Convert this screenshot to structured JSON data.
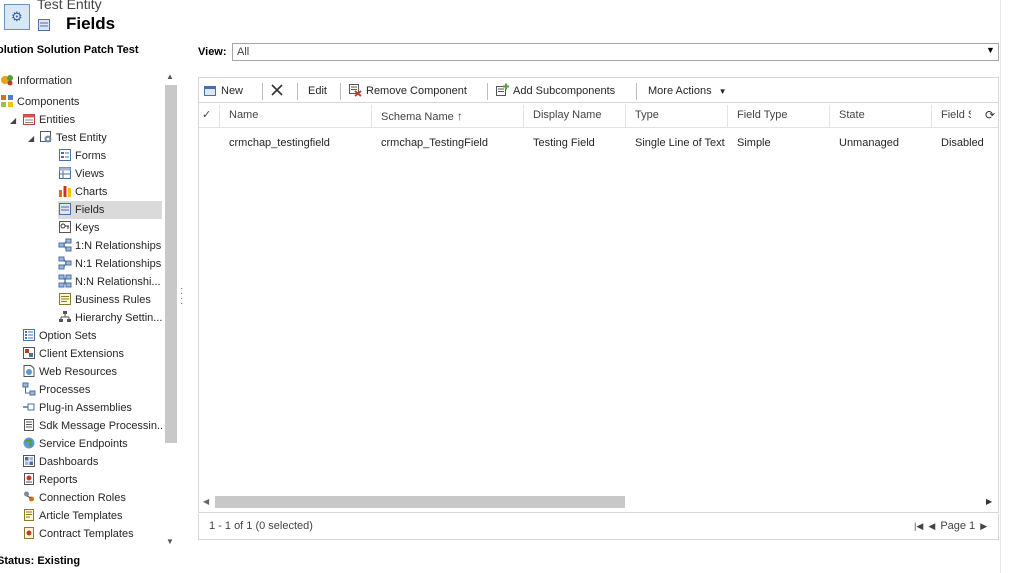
{
  "header": {
    "entity_title": "Test Entity",
    "page_title": "Fields"
  },
  "solution": {
    "title": "olution Solution Patch Test"
  },
  "nav": {
    "items": [
      {
        "label": "Information",
        "icon": "information-icon"
      },
      {
        "label": "Components",
        "icon": "components-icon"
      },
      {
        "label": "Entities",
        "icon": "entities-icon"
      },
      {
        "label": "Test Entity",
        "icon": "entity-icon"
      },
      {
        "label": "Forms",
        "icon": "forms-icon"
      },
      {
        "label": "Views",
        "icon": "views-icon"
      },
      {
        "label": "Charts",
        "icon": "charts-icon"
      },
      {
        "label": "Fields",
        "icon": "fields-icon",
        "selected": true
      },
      {
        "label": "Keys",
        "icon": "keys-icon"
      },
      {
        "label": "1:N Relationships",
        "icon": "relationship-icon"
      },
      {
        "label": "N:1 Relationships",
        "icon": "relationship-icon"
      },
      {
        "label": "N:N Relationshi...",
        "icon": "relationship-icon"
      },
      {
        "label": "Business Rules",
        "icon": "business-rules-icon"
      },
      {
        "label": "Hierarchy Settin...",
        "icon": "hierarchy-icon"
      },
      {
        "label": "Option Sets",
        "icon": "option-sets-icon"
      },
      {
        "label": "Client Extensions",
        "icon": "client-extensions-icon"
      },
      {
        "label": "Web Resources",
        "icon": "web-resources-icon"
      },
      {
        "label": "Processes",
        "icon": "processes-icon"
      },
      {
        "label": "Plug-in Assemblies",
        "icon": "plugin-icon"
      },
      {
        "label": "Sdk Message Processin...",
        "icon": "sdk-message-icon"
      },
      {
        "label": "Service Endpoints",
        "icon": "service-endpoints-icon"
      },
      {
        "label": "Dashboards",
        "icon": "dashboards-icon"
      },
      {
        "label": "Reports",
        "icon": "reports-icon"
      },
      {
        "label": "Connection Roles",
        "icon": "connection-roles-icon"
      },
      {
        "label": "Article Templates",
        "icon": "article-templates-icon"
      },
      {
        "label": "Contract Templates",
        "icon": "contract-templates-icon"
      }
    ]
  },
  "status": {
    "text": "Status: Existing"
  },
  "view": {
    "label": "View:",
    "selected": "All"
  },
  "toolbar": {
    "new_label": "New",
    "edit_label": "Edit",
    "remove_label": "Remove Component",
    "add_sub_label": "Add Subcomponents",
    "more_actions_label": "More Actions"
  },
  "grid": {
    "columns": [
      "Name",
      "Schema Name",
      "Display Name",
      "Type",
      "Field Type",
      "State",
      "Field S"
    ],
    "sort_indicator": "↑",
    "rows": [
      {
        "name": "crmchap_testingfield",
        "schema_name": "crmchap_TestingField",
        "display_name": "Testing Field",
        "type": "Single Line of Text",
        "field_type": "Simple",
        "state": "Unmanaged",
        "field_security": "Disabled"
      }
    ]
  },
  "footer": {
    "record_count": "1 - 1 of 1 (0 selected)",
    "page_label": "Page 1"
  },
  "colors": {
    "selected_bg": "#dadada",
    "scrollbar_thumb": "#c8c8c8",
    "icon_blue": "#2d5e9e"
  }
}
